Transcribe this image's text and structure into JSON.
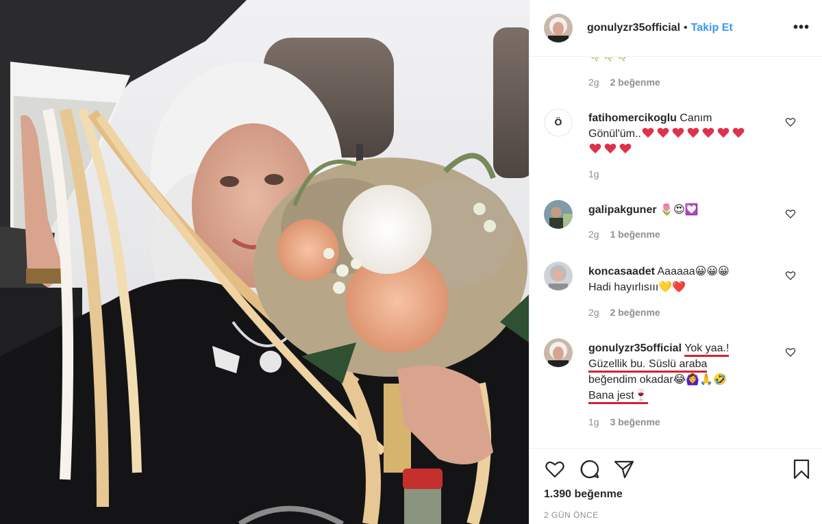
{
  "header": {
    "username": "gonulyzr35official",
    "separator": "•",
    "follow_label": "Takip Et",
    "more_label": "•••"
  },
  "comments": [
    {
      "id": "c0",
      "partial_text": "🍀🍀🍀",
      "time": "2g",
      "likes": "2 beğenme"
    },
    {
      "id": "c1",
      "username": "fatihomercikoglu",
      "text_line1": "Canım",
      "text_line2": "Gönül'üm..",
      "emoji_row1": [
        "heart-sparkle",
        "heart-sparkle",
        "heart-sparkle",
        "heart-sparkle",
        "heart-sparkle",
        "heart-sparkle",
        "heart-sparkle"
      ],
      "emoji_row2": [
        "heart-sparkle",
        "heart-sparkle",
        "heart-sparkle"
      ],
      "time": "1g",
      "likes": ""
    },
    {
      "id": "c2",
      "username": "galipakguner",
      "text": "🌷😍💟",
      "time": "2g",
      "likes": "1 beğenme"
    },
    {
      "id": "c3",
      "username": "koncasaadet",
      "text_line1": "Aaaaaa😀😀😀",
      "text_line2": "Hadi hayırlısııı💛❤️",
      "time": "2g",
      "likes": "2 beğenme"
    },
    {
      "id": "c4",
      "username": "gonulyzr35official",
      "text_line1": "Yok yaa.!",
      "text_line2a": "Güzellik bu. Süslü araba",
      "text_line3": "beğendim okadar😂🙆‍♀️🙏🤣",
      "text_line4": "Bana jest🍷",
      "time": "1g",
      "likes": "3 beğenme"
    }
  ],
  "actions": {
    "likes_total": "1.390 beğenme",
    "timestamp": "2 GÜN ÖNCE"
  },
  "colors": {
    "link": "#3897f0",
    "meta": "#8e8e8e",
    "text": "#262626",
    "underline": "#d8202e",
    "divider": "#efefef"
  },
  "icons": [
    "heart-icon",
    "comment-icon",
    "share-icon",
    "bookmark-icon",
    "more-options-icon",
    "comment-like-heart-icon"
  ]
}
